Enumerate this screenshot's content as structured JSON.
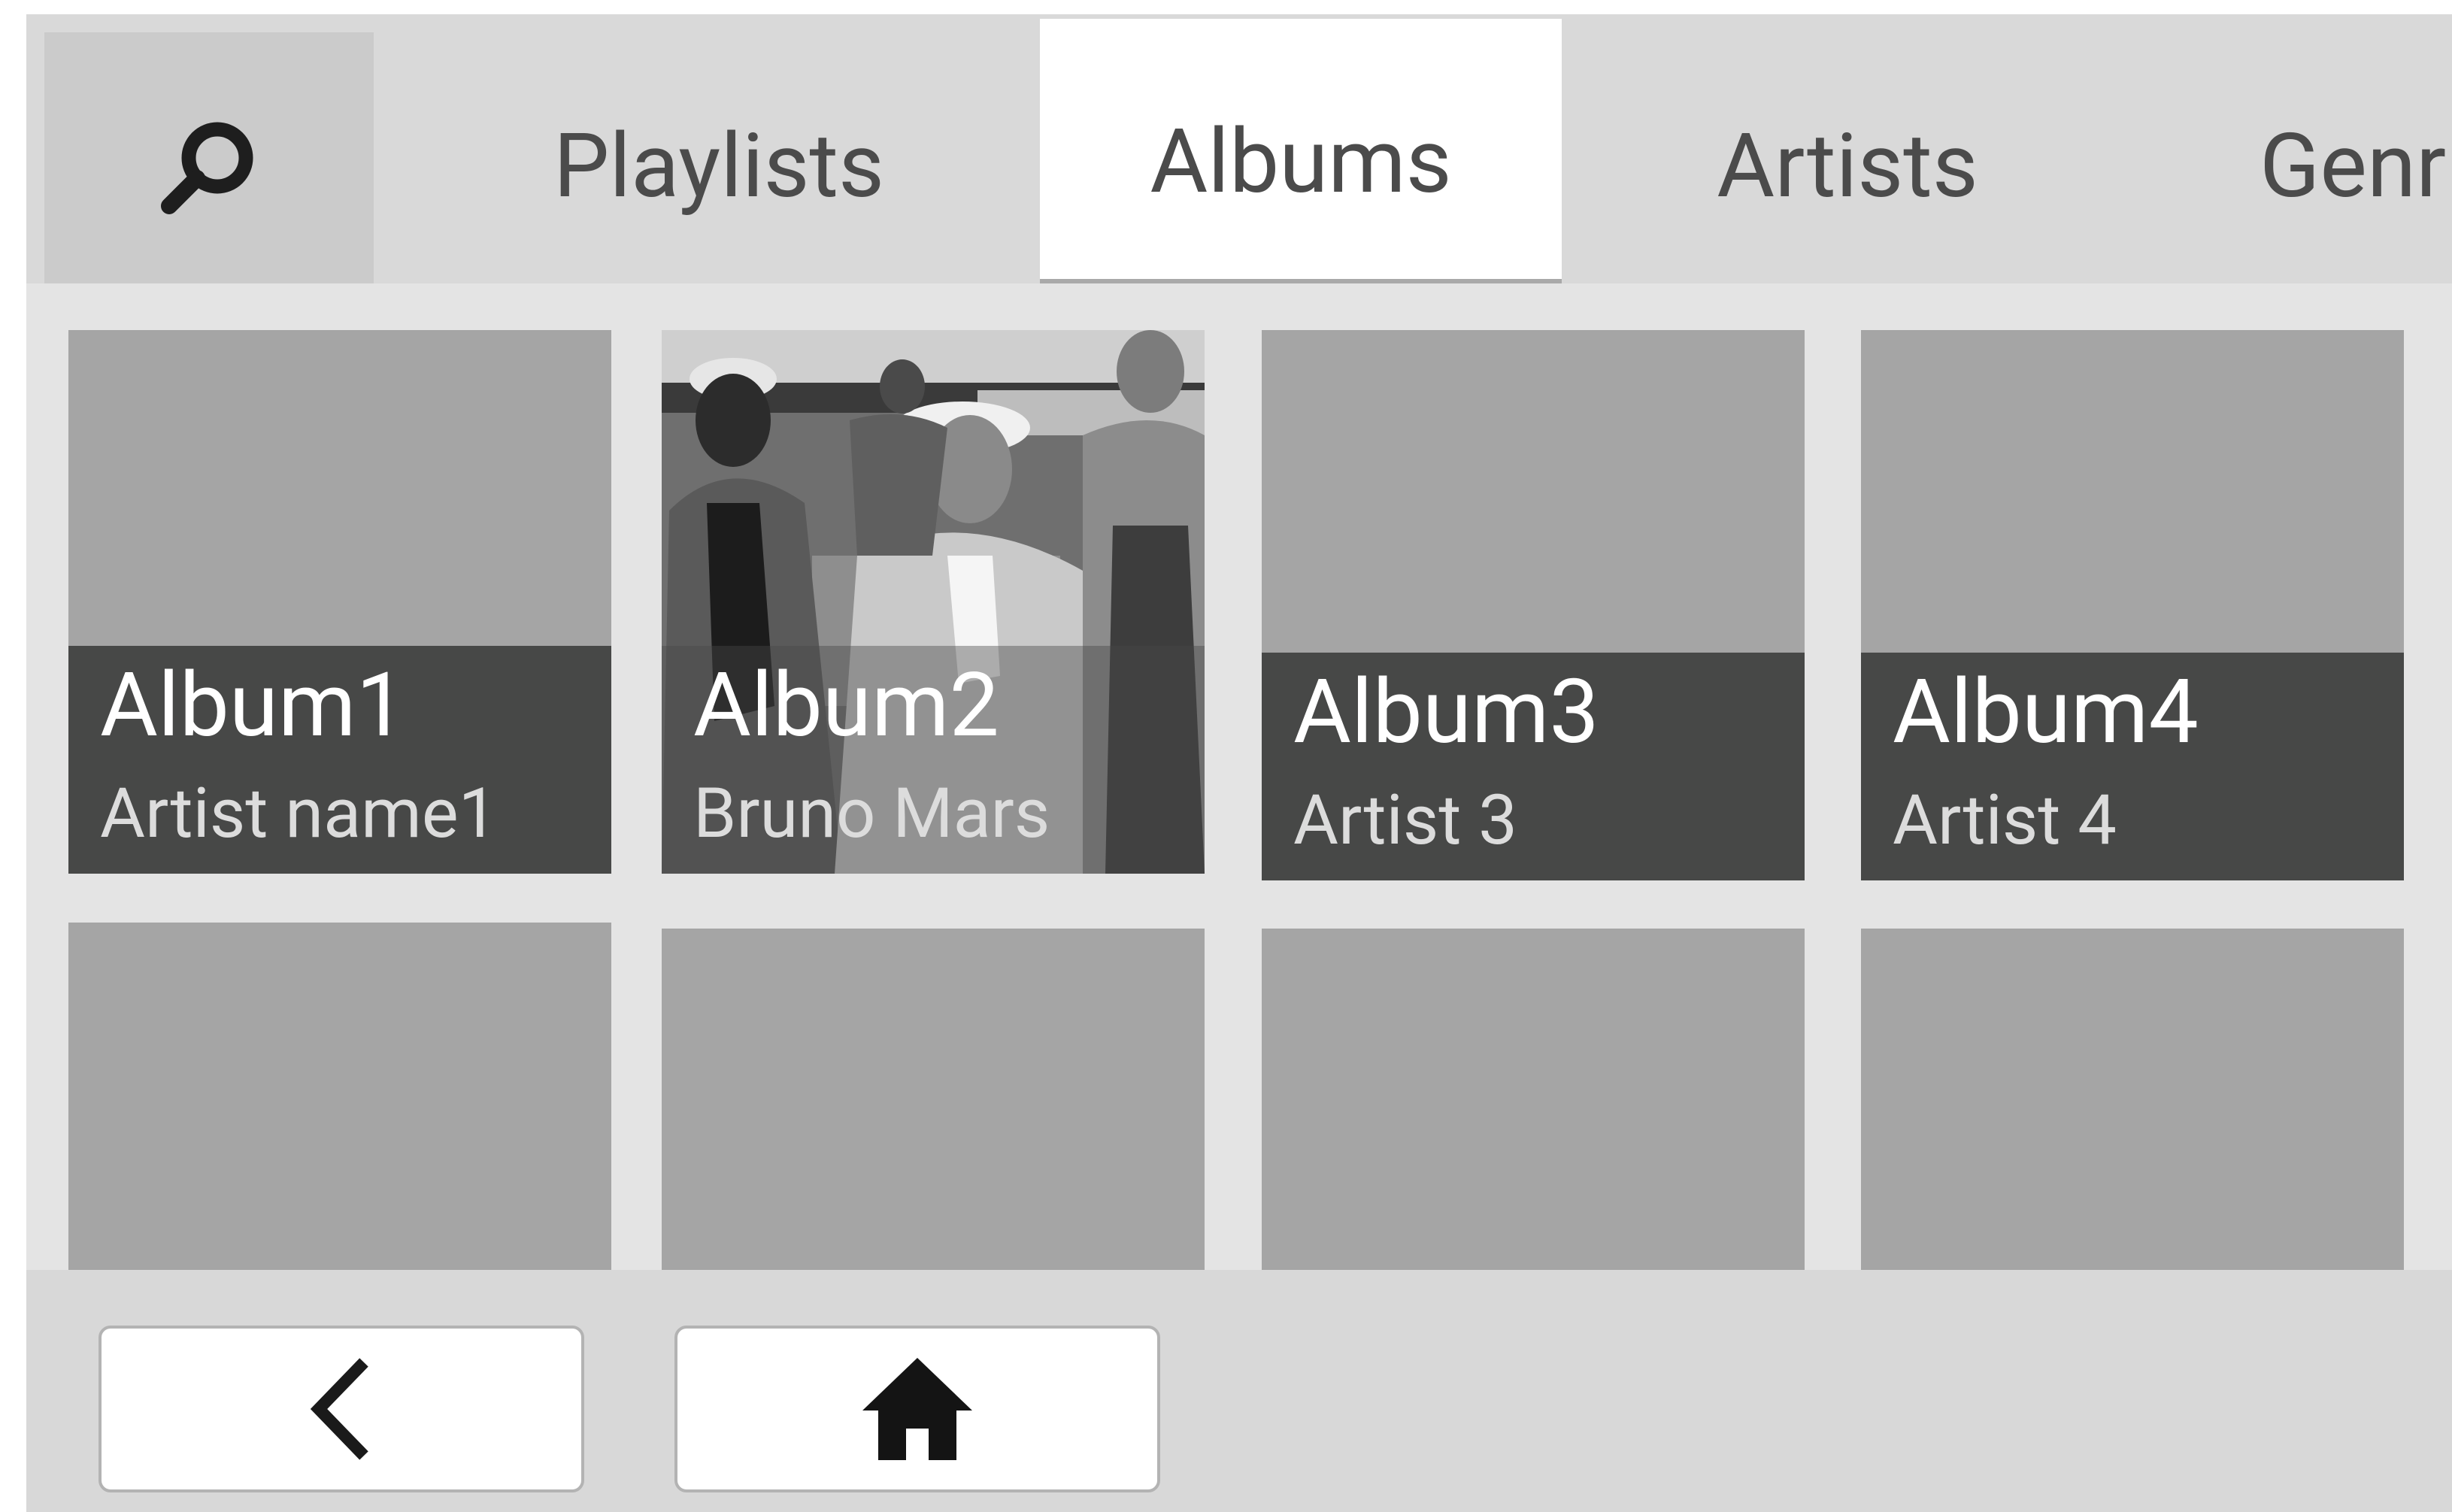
{
  "toolbar": {
    "search_icon": "search-icon"
  },
  "tabs": [
    {
      "label": "Playlists",
      "selected": false
    },
    {
      "label": "Albums",
      "selected": true
    },
    {
      "label": "Artists",
      "selected": false
    },
    {
      "label": "Genr",
      "selected": false
    }
  ],
  "albums": [
    {
      "title": "Album1",
      "artist": "Artist name1"
    },
    {
      "title": "Album2",
      "artist": "Bruno Mars",
      "has_cover_art": true
    },
    {
      "title": "Album3",
      "artist": "Artist 3"
    },
    {
      "title": "Album4",
      "artist": "Artist 4"
    },
    {
      "title": "",
      "artist": ""
    },
    {
      "title": "",
      "artist": ""
    },
    {
      "title": "",
      "artist": ""
    },
    {
      "title": "",
      "artist": ""
    }
  ],
  "bottom_nav": {
    "back_icon": "chevron-left-icon",
    "home_icon": "home-icon"
  },
  "colors": {
    "tab_bar": "#d9d9d9",
    "selected_tab": "#ffffff",
    "tile_placeholder": "#a5a5a5",
    "caption_band": "#474847",
    "content_background": "#e4e4e4"
  }
}
